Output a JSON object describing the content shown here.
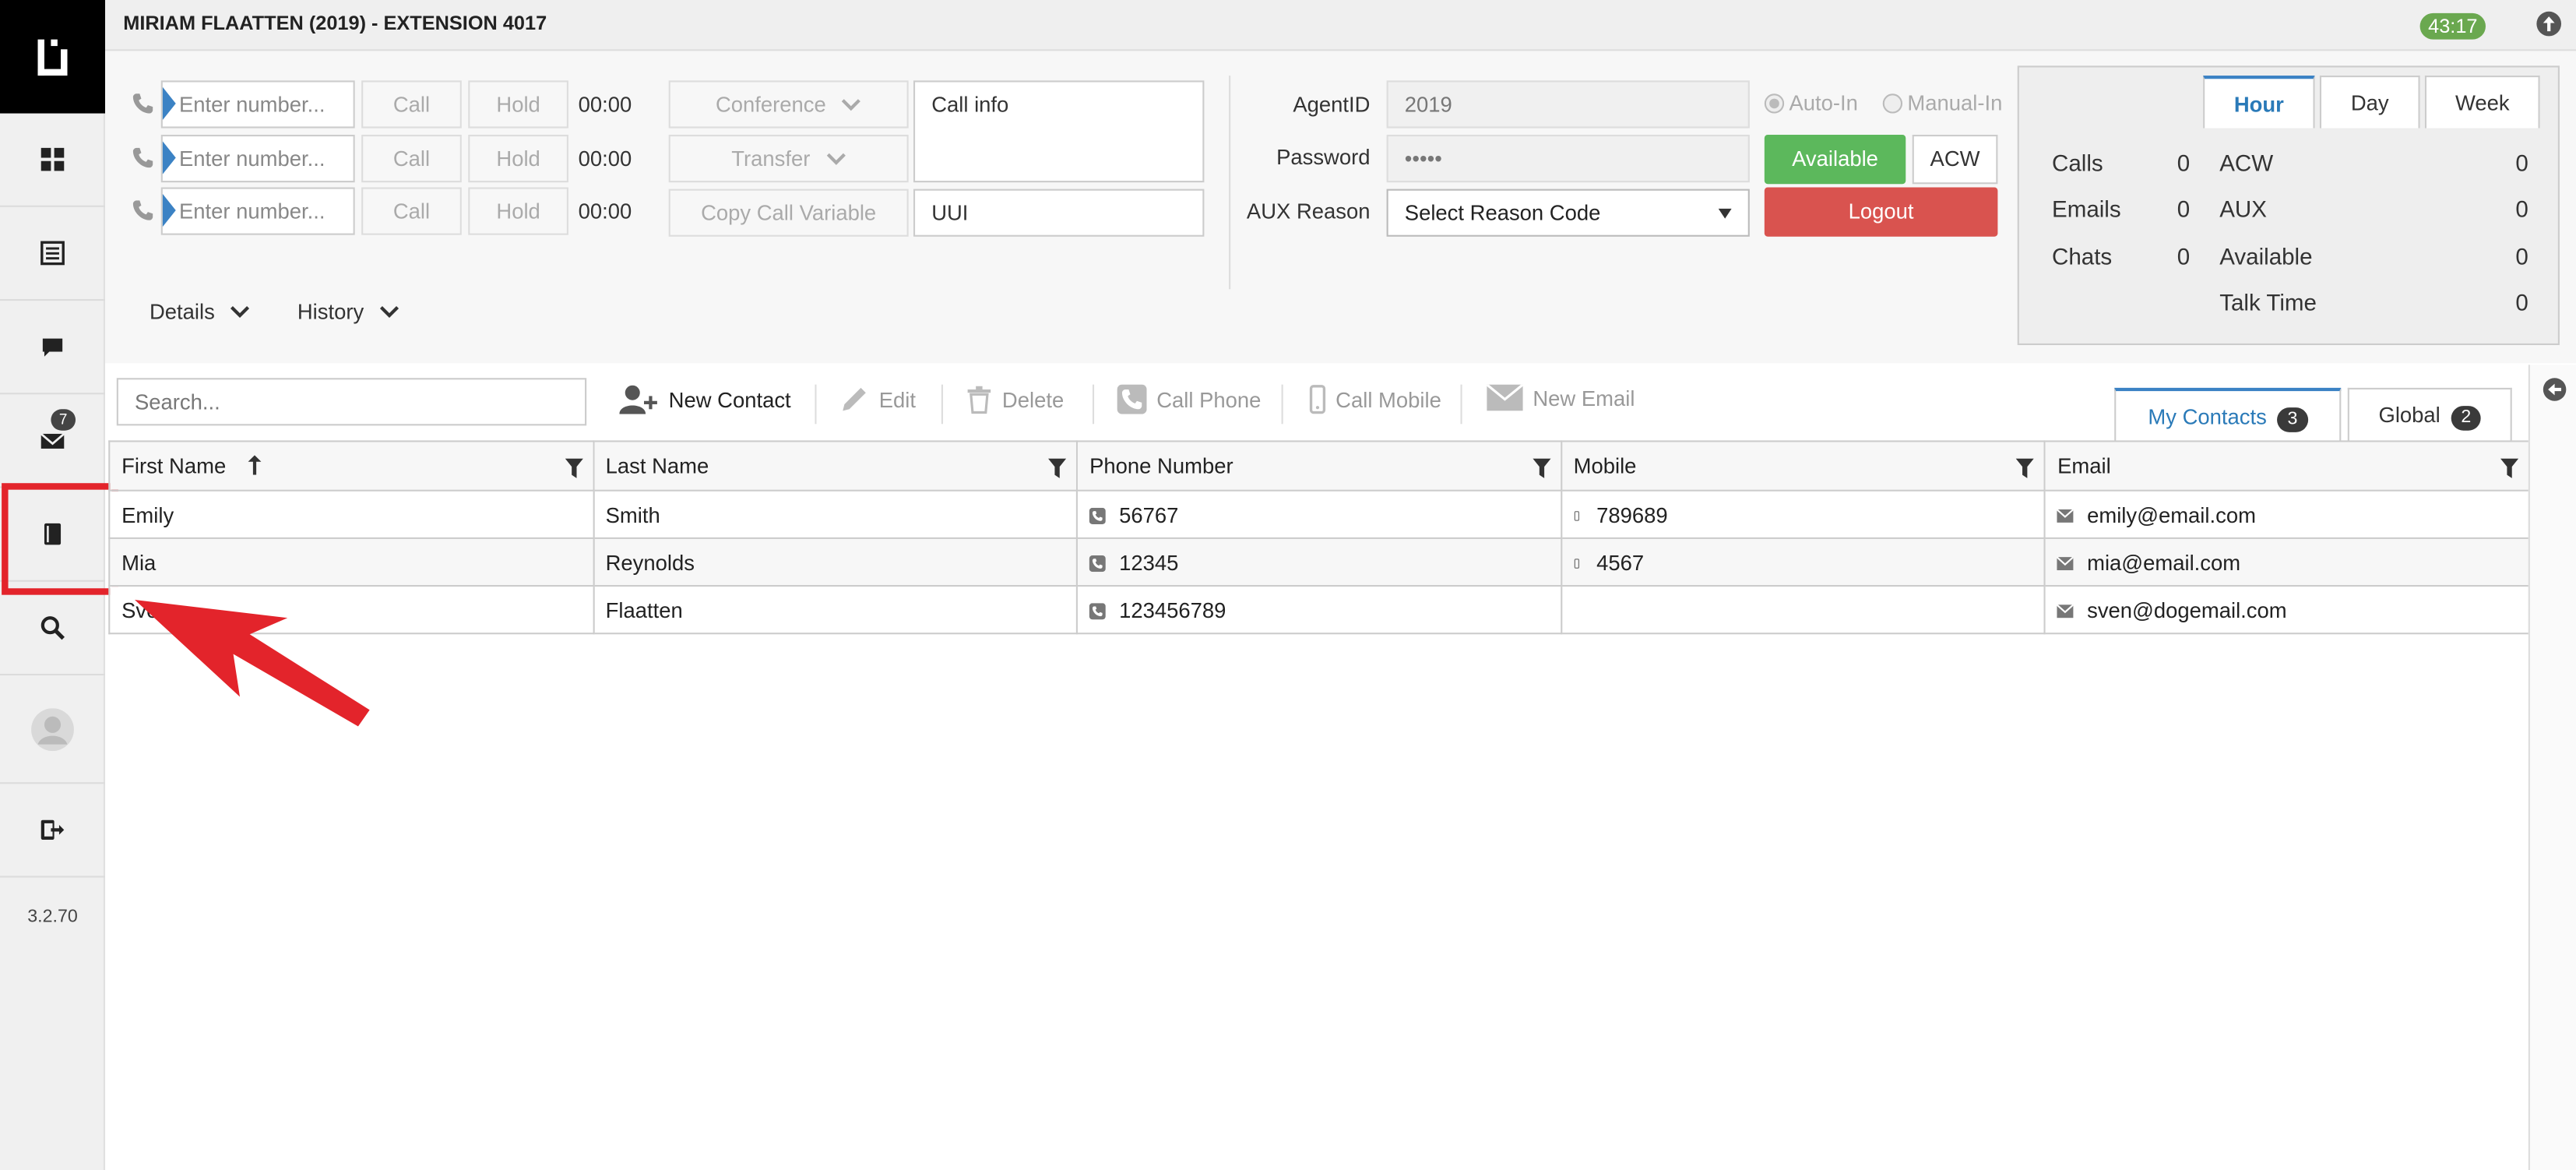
{
  "header": {
    "title": "MIRIAM FLAATTEN (2019) - EXTENSION 4017",
    "timer": "43:17"
  },
  "sidebar": {
    "items": [
      {
        "name": "dashboard",
        "icon": "dashboard-icon"
      },
      {
        "name": "list",
        "icon": "list-icon"
      },
      {
        "name": "chat",
        "icon": "chat-icon"
      },
      {
        "name": "email",
        "icon": "envelope-icon",
        "badge": "7"
      },
      {
        "name": "contacts",
        "icon": "address-book-icon"
      },
      {
        "name": "search",
        "icon": "search-icon"
      },
      {
        "name": "profile",
        "icon": "user-icon"
      },
      {
        "name": "logout",
        "icon": "sign-out-icon"
      }
    ],
    "version": "3.2.70"
  },
  "phone_lines": [
    {
      "placeholder": "Enter number...",
      "call": "Call",
      "hold": "Hold",
      "time": "00:00"
    },
    {
      "placeholder": "Enter number...",
      "call": "Call",
      "hold": "Hold",
      "time": "00:00"
    },
    {
      "placeholder": "Enter number...",
      "call": "Call",
      "hold": "Hold",
      "time": "00:00"
    }
  ],
  "actions": {
    "conference": "Conference",
    "transfer": "Transfer",
    "copy_call_variable": "Copy Call Variable"
  },
  "call_info": {
    "label": "Call info",
    "uui": "UUI"
  },
  "agent": {
    "agentid_label": "AgentID",
    "agentid_value": "2019",
    "password_label": "Password",
    "password_value": "•••••",
    "aux_label": "AUX Reason",
    "aux_select": "Select Reason Code",
    "auto_in": "Auto-In",
    "manual_in": "Manual-In",
    "available": "Available",
    "acw": "ACW",
    "logout": "Logout"
  },
  "toggles": {
    "details": "Details",
    "history": "History"
  },
  "stats": {
    "tabs": [
      "Hour",
      "Day",
      "Week"
    ],
    "active_tab": "Hour",
    "left": [
      {
        "label": "Calls",
        "value": "0"
      },
      {
        "label": "Emails",
        "value": "0"
      },
      {
        "label": "Chats",
        "value": "0"
      }
    ],
    "right": [
      {
        "label": "ACW",
        "value": "0"
      },
      {
        "label": "AUX",
        "value": "0"
      },
      {
        "label": "Available",
        "value": "0"
      },
      {
        "label": "Talk Time",
        "value": "0"
      }
    ]
  },
  "toolbar": {
    "search_placeholder": "Search...",
    "new_contact": "New Contact",
    "edit": "Edit",
    "delete": "Delete",
    "call_phone": "Call Phone",
    "call_mobile": "Call Mobile",
    "new_email": "New Email"
  },
  "contact_tabs": [
    {
      "label": "My Contacts",
      "count": "3"
    },
    {
      "label": "Global",
      "count": "2"
    }
  ],
  "table": {
    "columns": [
      "First Name",
      "Last Name",
      "Phone Number",
      "Mobile",
      "Email"
    ],
    "rows": [
      {
        "first": "Emily",
        "last": "Smith",
        "phone": "56767",
        "mobile": "789689",
        "email": "emily@email.com"
      },
      {
        "first": "Mia",
        "last": "Reynolds",
        "phone": "12345",
        "mobile": "4567",
        "email": "mia@email.com"
      },
      {
        "first": "Sven",
        "last": "Flaatten",
        "phone": "123456789",
        "mobile": "",
        "email": "sven@dogemail.com"
      }
    ]
  },
  "colors": {
    "accent": "#3b82c4",
    "available": "#5cb85c",
    "logout": "#d9534f",
    "annotation": "#e3242b",
    "timer": "#6aa84f"
  }
}
